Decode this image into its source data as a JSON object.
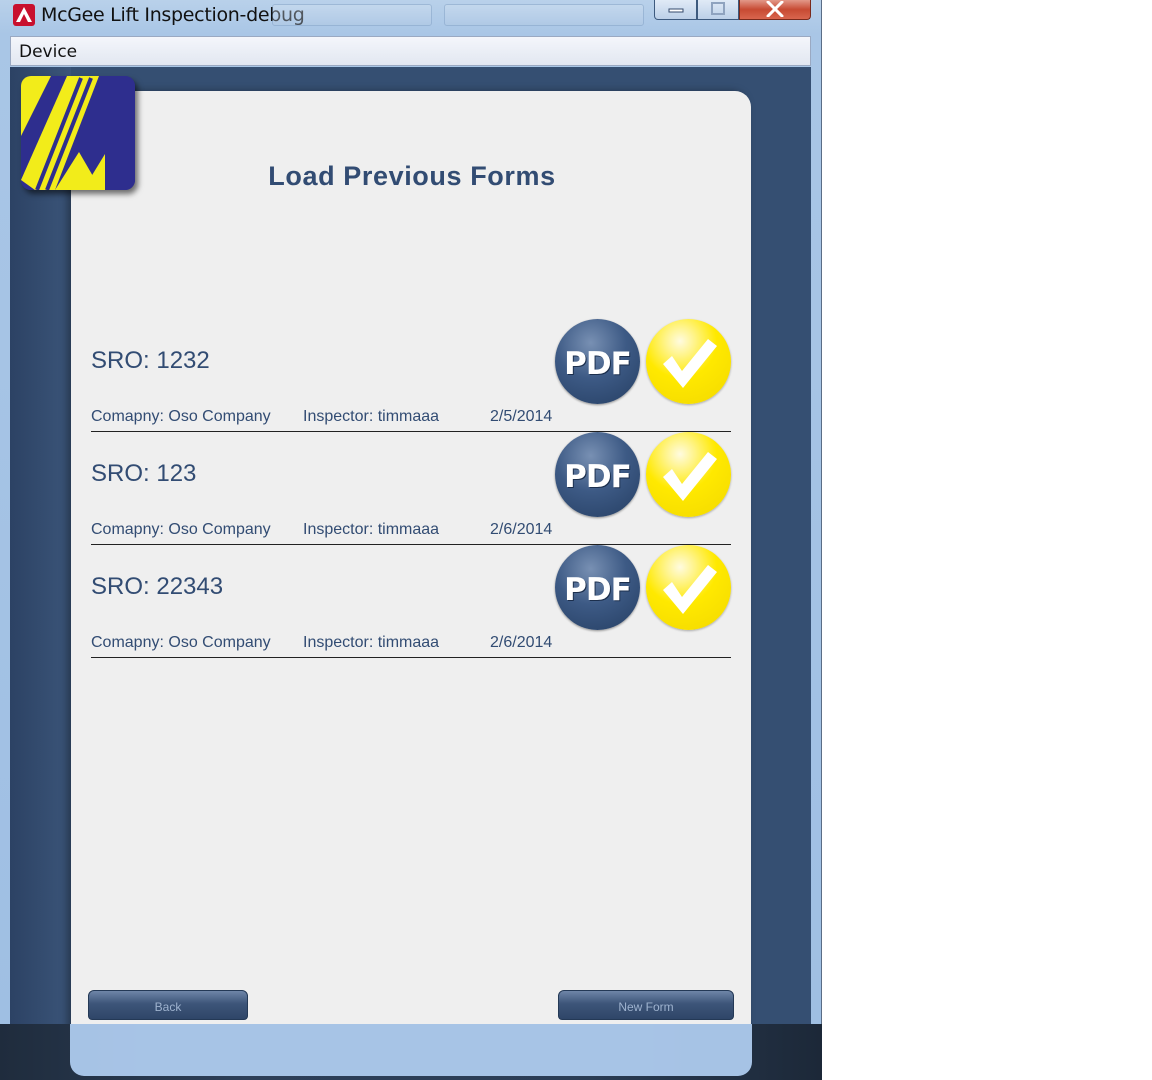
{
  "window": {
    "title": "McGee Lift Inspection-debug"
  },
  "menu": {
    "device_label": "Device"
  },
  "page": {
    "title": "Load Previous Forms"
  },
  "forms": [
    {
      "sro": "SRO: 1232",
      "company": "Comapny: Oso Company",
      "inspector": "Inspector: timmaaa",
      "date": "2/5/2014"
    },
    {
      "sro": "SRO: 123",
      "company": "Comapny: Oso Company",
      "inspector": "Inspector: timmaaa",
      "date": "2/6/2014"
    },
    {
      "sro": "SRO: 22343",
      "company": "Comapny: Oso Company",
      "inspector": "Inspector: timmaaa",
      "date": "2/6/2014"
    }
  ],
  "buttons": {
    "pdf_label": "PDF",
    "back_label": "Back",
    "new_form_label": "New Form"
  },
  "icons": {
    "app": "adobe-air-icon",
    "logo": "mcgee-logo",
    "pdf": "pdf-icon",
    "check": "checkmark-icon",
    "minimize": "minimize-icon",
    "maximize": "maximize-icon",
    "close": "close-icon"
  },
  "colors": {
    "app_background": "#354f72",
    "panel_background": "#efefef",
    "text_accent": "#324c73",
    "check_yellow": "#ffe900",
    "pdf_blue": "#3d5a85"
  }
}
